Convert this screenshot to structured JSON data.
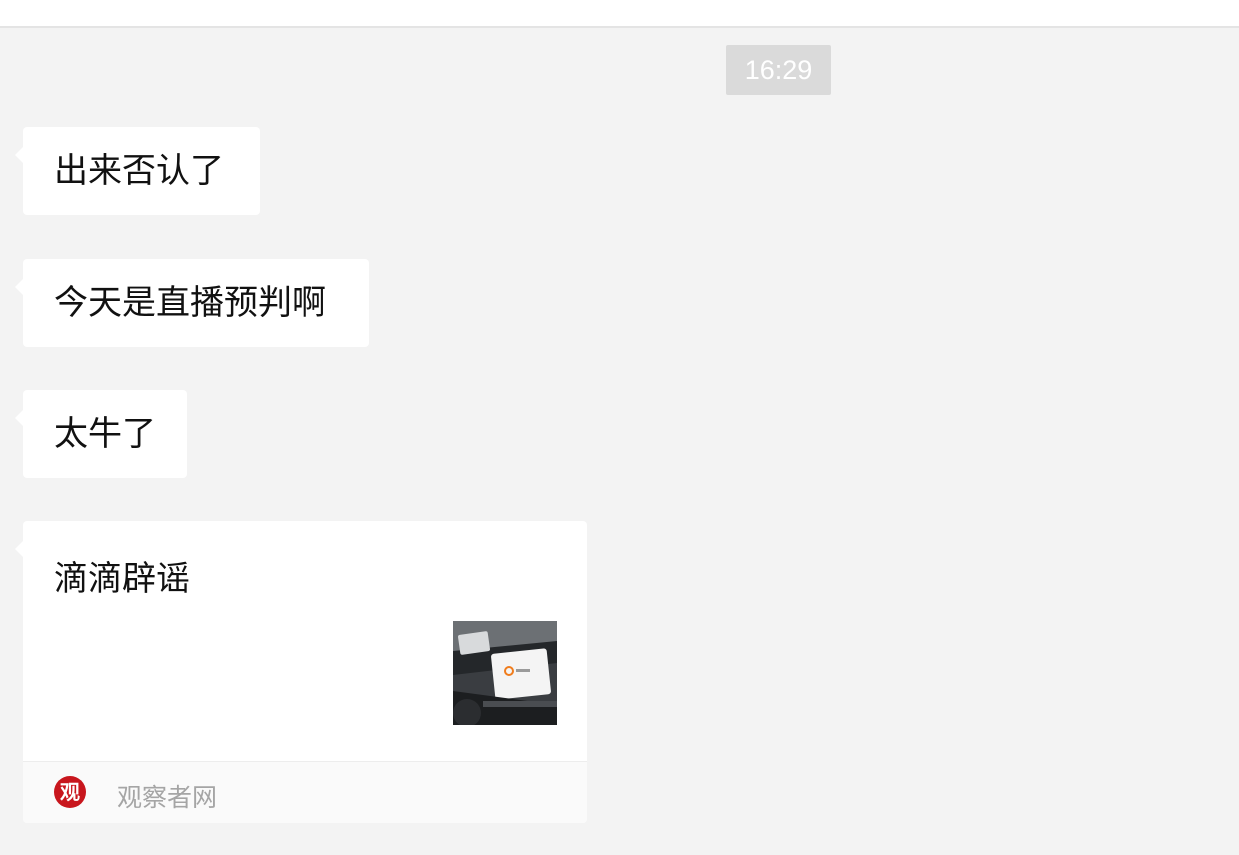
{
  "timestamp": "16:29",
  "messages": [
    {
      "text": "出来否认了"
    },
    {
      "text": "今天是直播预判啊"
    },
    {
      "text": "太牛了"
    }
  ],
  "link_card": {
    "title": "滴滴辟谣",
    "thumbnail_icon": "car-dashboard-screen-thumbnail",
    "source_logo_char": "观",
    "source_name": "观察者网"
  },
  "colors": {
    "background": "#f3f3f3",
    "bubble": "#ffffff",
    "timestamp_bg": "#dadada",
    "source_logo": "#c8161d"
  }
}
